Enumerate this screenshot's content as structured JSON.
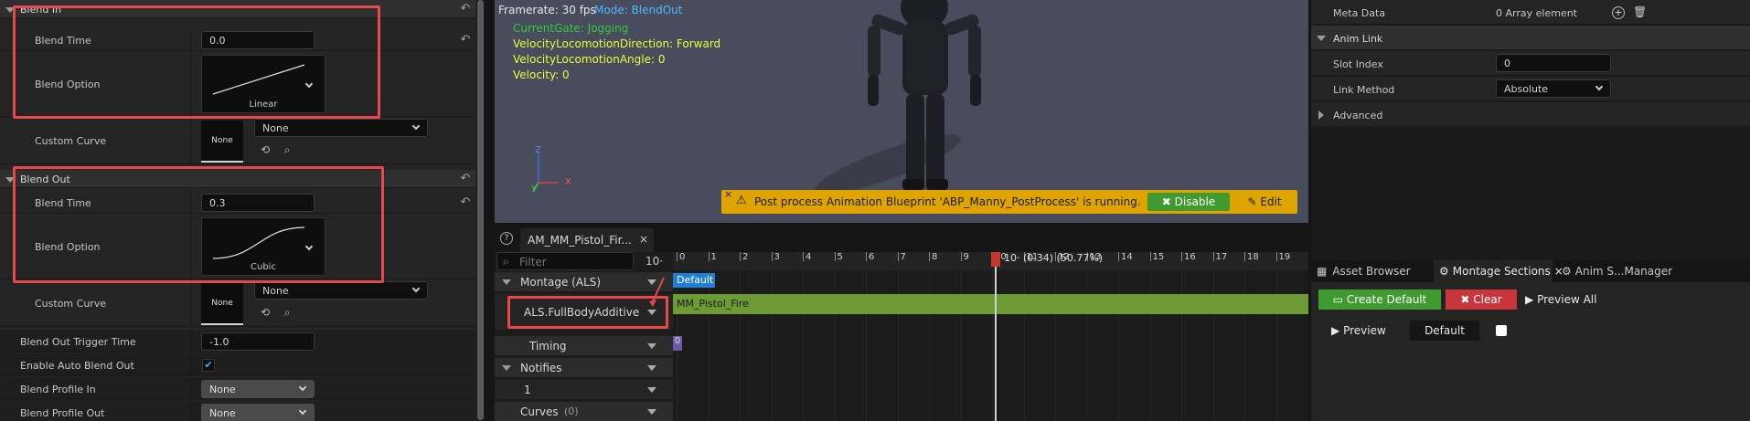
{
  "details": {
    "blend_in": {
      "header": "Blend In",
      "blend_time_label": "Blend Time",
      "blend_time_value": "0.0",
      "blend_option_label": "Blend Option",
      "blend_option_value": "Linear",
      "custom_curve_label": "Custom Curve",
      "custom_curve_thumb": "None",
      "custom_curve_value": "None"
    },
    "blend_out": {
      "header": "Blend Out",
      "blend_time_label": "Blend Time",
      "blend_time_value": "0.3",
      "blend_option_label": "Blend Option",
      "blend_option_value": "Cubic",
      "custom_curve_label": "Custom Curve",
      "custom_curve_thumb": "None",
      "custom_curve_value": "None"
    },
    "blend_out_trigger_time_label": "Blend Out Trigger Time",
    "blend_out_trigger_time_value": "-1.0",
    "enable_auto_blend_out_label": "Enable Auto Blend Out",
    "enable_auto_blend_out_checked": true,
    "blend_profile_in_label": "Blend Profile In",
    "blend_profile_in_value": "None",
    "blend_profile_out_label": "Blend Profile Out",
    "blend_profile_out_value": "None"
  },
  "viewport": {
    "framerate": "Framerate: 30 fps",
    "mode": "Mode: BlendOut",
    "current_gate": "CurrentGate: Jogging",
    "loco_direction": "VelocityLocomotionDirection: Forward",
    "loco_angle": "VelocityLocomotionAngle: 0",
    "velocity": "Velocity: 0",
    "axis_x": "X",
    "axis_y": "Y",
    "axis_z": "Z",
    "warning_text": "Post process Animation Blueprint 'ABP_Manny_PostProcess' is running.",
    "disable_label": "Disable",
    "edit_label": "Edit"
  },
  "montage": {
    "tab_title": "AM_MM_Pistol_Fir...",
    "filter_placeholder": "Filter",
    "snap_label": "10·",
    "tracks": {
      "montage": "Montage (ALS)",
      "slot": "ALS.FullBodyAdditive",
      "timing": "Timing",
      "notifies": "Notifies",
      "notifies_count": "1",
      "curves": "Curves",
      "curves_count": "(0)"
    },
    "timeline_ticks": [
      "0",
      "1",
      "2",
      "3",
      "4",
      "5",
      "6",
      "7",
      "8",
      "9",
      "10",
      "11",
      "12",
      "13",
      "14",
      "15",
      "16",
      "17",
      "18",
      "19"
    ],
    "playhead_label": "10· (0.34) (50.77%)",
    "section_label": "Default",
    "segment_label": "MM_Pistol_Fire",
    "timing_marker": "0"
  },
  "right": {
    "meta_data_label": "Meta Data",
    "meta_data_value": "0 Array element",
    "anim_link_header": "Anim Link",
    "slot_index_label": "Slot Index",
    "slot_index_value": "0",
    "link_method_label": "Link Method",
    "link_method_value": "Absolute",
    "advanced_label": "Advanced",
    "tabs": [
      "Asset Browser",
      "Montage Sections",
      "Anim S...Manager"
    ],
    "create_default_label": "Create Default",
    "clear_label": "Clear",
    "preview_all_label": "Preview All",
    "preview_label": "Preview",
    "default_section_label": "Default"
  },
  "colors": {
    "highlight": "#e5484d",
    "warning_bar": "#e0a400",
    "disable_button": "#3f9a2f",
    "segment_green": "#6c9a34",
    "create_default_green": "#3f9a2f",
    "clear_red": "#c8353b",
    "section_blue": "#1f7fd6"
  }
}
